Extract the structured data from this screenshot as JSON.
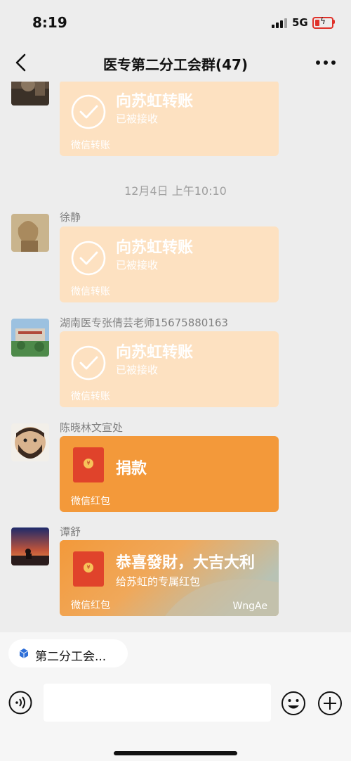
{
  "status_bar": {
    "time": "8:19",
    "network": "5G",
    "battery_color": "#e0322a"
  },
  "nav": {
    "title": "医专第二分工会群(47)",
    "back_icon": "chevron-left-icon",
    "more_icon": "more-dots-icon"
  },
  "messages": [
    {
      "type": "transfer",
      "title": "向苏虹转账",
      "status": "已被接收",
      "footer": "微信转账"
    },
    {
      "type": "timestamp",
      "text": "12月4日 上午10:10"
    },
    {
      "type": "transfer",
      "sender": "徐静",
      "title": "向苏虹转账",
      "status": "已被接收",
      "footer": "微信转账"
    },
    {
      "type": "transfer",
      "sender": "湖南医专张倩芸老师15675880163",
      "title": "向苏虹转账",
      "status": "已被接收",
      "footer": "微信转账"
    },
    {
      "type": "red_packet",
      "sender": "陈晓林文宣处",
      "title": "捐款",
      "footer": "微信红包"
    },
    {
      "type": "red_packet",
      "sender": "谭舒",
      "title": "恭喜發財，大吉大利",
      "subtitle": "给苏虹的专属红包",
      "footer": "微信红包",
      "cover_text": "WngAe"
    }
  ],
  "input_bar": {
    "chip_label": "第二分工会...",
    "text_value": ""
  },
  "colors": {
    "background": "#ededed",
    "transfer_bubble": "#fde1c1",
    "red_packet_bubble": "#f3993a"
  }
}
